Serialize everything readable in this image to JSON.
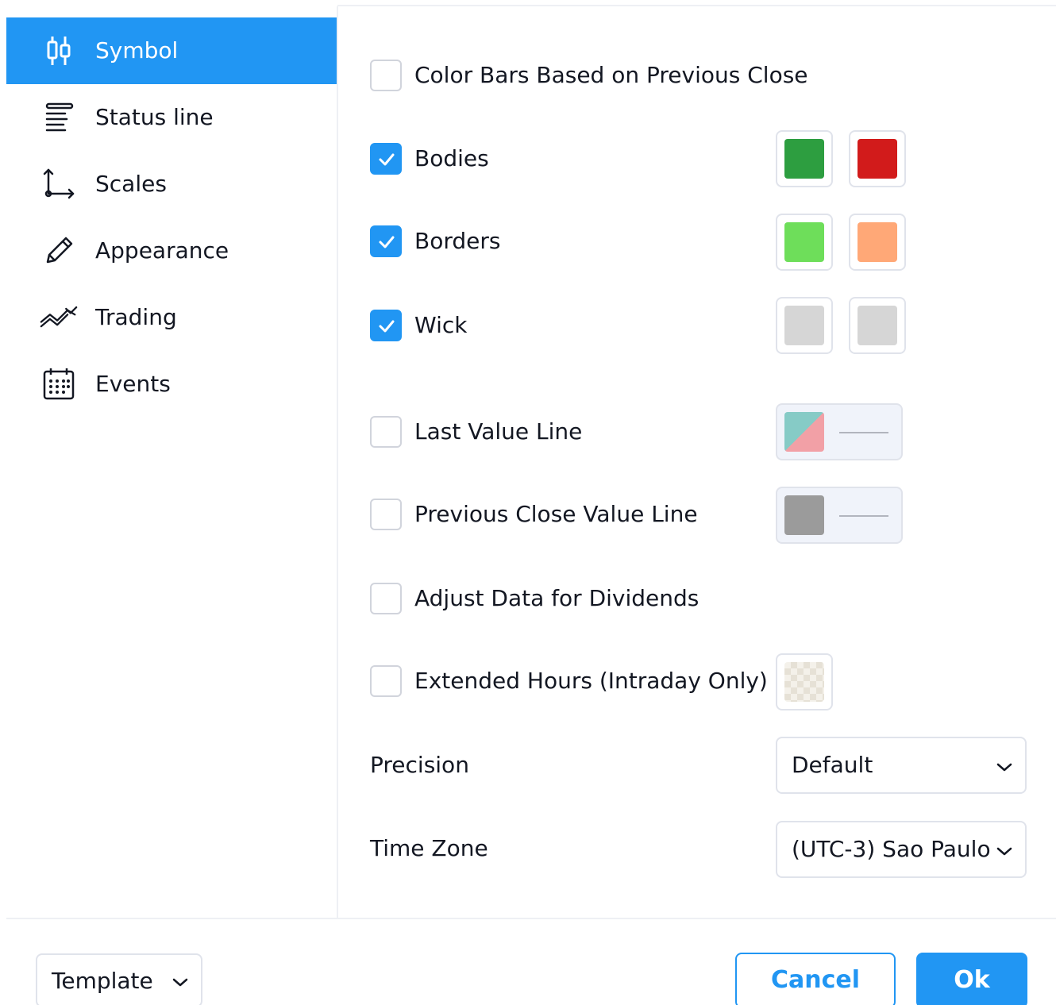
{
  "sidebar": {
    "items": [
      {
        "label": "Symbol",
        "icon": "candles-icon",
        "active": true
      },
      {
        "label": "Status line",
        "icon": "status-line-icon"
      },
      {
        "label": "Scales",
        "icon": "scales-icon"
      },
      {
        "label": "Appearance",
        "icon": "pencil-icon"
      },
      {
        "label": "Trading",
        "icon": "trading-icon"
      },
      {
        "label": "Events",
        "icon": "calendar-icon"
      }
    ]
  },
  "settings": {
    "color_bars": {
      "label": "Color Bars Based on Previous Close",
      "checked": false
    },
    "bodies": {
      "label": "Bodies",
      "checked": true,
      "up_color": "#2d9e40",
      "down_color": "#d21b1b"
    },
    "borders": {
      "label": "Borders",
      "checked": true,
      "up_color": "#6ede5a",
      "down_color": "#ffa877"
    },
    "wick": {
      "label": "Wick",
      "checked": true,
      "up_color": "#d6d6d6",
      "down_color": "#d6d6d6"
    },
    "last_value_line": {
      "label": "Last Value Line",
      "checked": false,
      "color_a": "#f2a0a6",
      "color_b": "#86cbc6"
    },
    "prev_close_line": {
      "label": "Previous Close Value Line",
      "checked": false,
      "color": "#9b9b9b"
    },
    "adjust_dividends": {
      "label": "Adjust Data for Dividends",
      "checked": false
    },
    "extended_hours": {
      "label": "Extended Hours (Intraday Only)",
      "checked": false
    },
    "precision": {
      "label": "Precision",
      "value": "Default"
    },
    "time_zone": {
      "label": "Time Zone",
      "value": "(UTC-3) Sao Paulo"
    }
  },
  "footer": {
    "template_label": "Template",
    "cancel_label": "Cancel",
    "ok_label": "Ok"
  },
  "colors": {
    "accent": "#2196f3",
    "border": "#e0e3eb",
    "text": "#131722"
  }
}
